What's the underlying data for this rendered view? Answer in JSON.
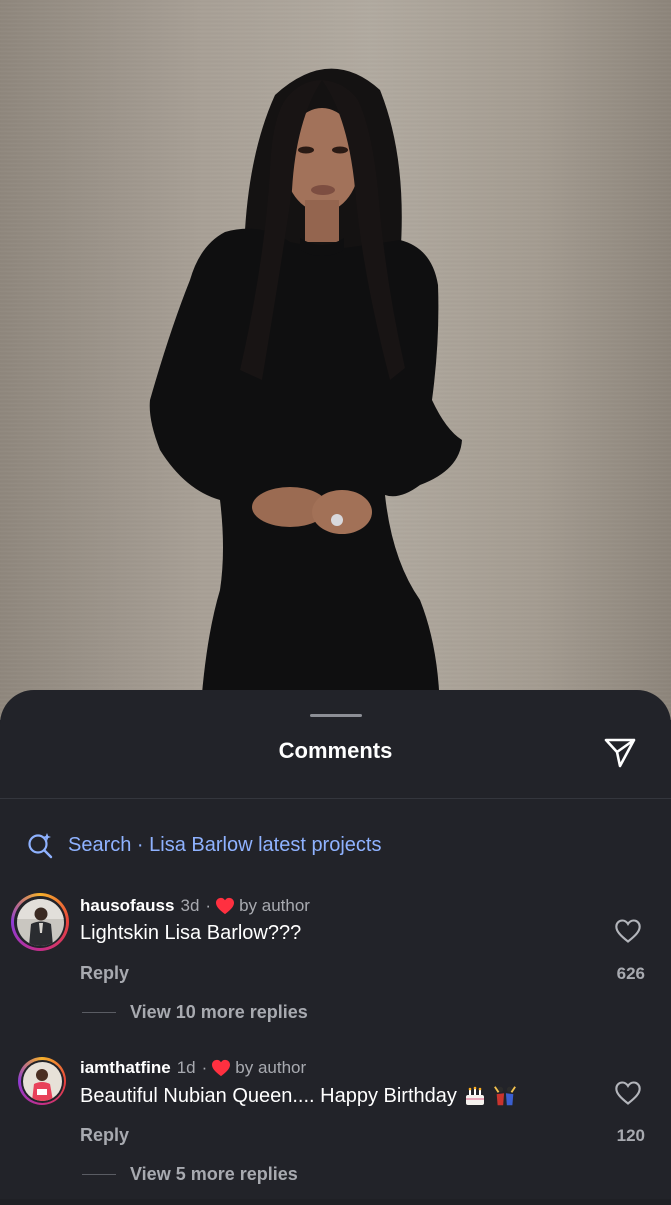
{
  "sheet": {
    "title": "Comments",
    "share_icon": "send-icon",
    "search_icon": "ai-search-icon",
    "search_text": "Search · Lisa Barlow latest projects"
  },
  "comments": [
    {
      "username": "hausofauss",
      "time": "3d",
      "separator": "·",
      "liked_by_author": "by author",
      "text": "Lightskin Lisa Barlow???",
      "reply_label": "Reply",
      "likes": "626",
      "view_more": "View 10 more replies"
    },
    {
      "username": "iamthatfine",
      "time": "1d",
      "separator": "·",
      "liked_by_author": "by author",
      "text": "Beautiful Nubian Queen.... Happy Birthday",
      "emojis": [
        "birthday-cake-emoji",
        "dancers-emoji"
      ],
      "reply_label": "Reply",
      "likes": "120",
      "view_more": "View 5 more replies"
    }
  ],
  "colors": {
    "sheet_bg": "#222329",
    "accent_link": "#8fb2ff",
    "heart_red": "#ff3040",
    "muted_text": "#a8aab0"
  }
}
